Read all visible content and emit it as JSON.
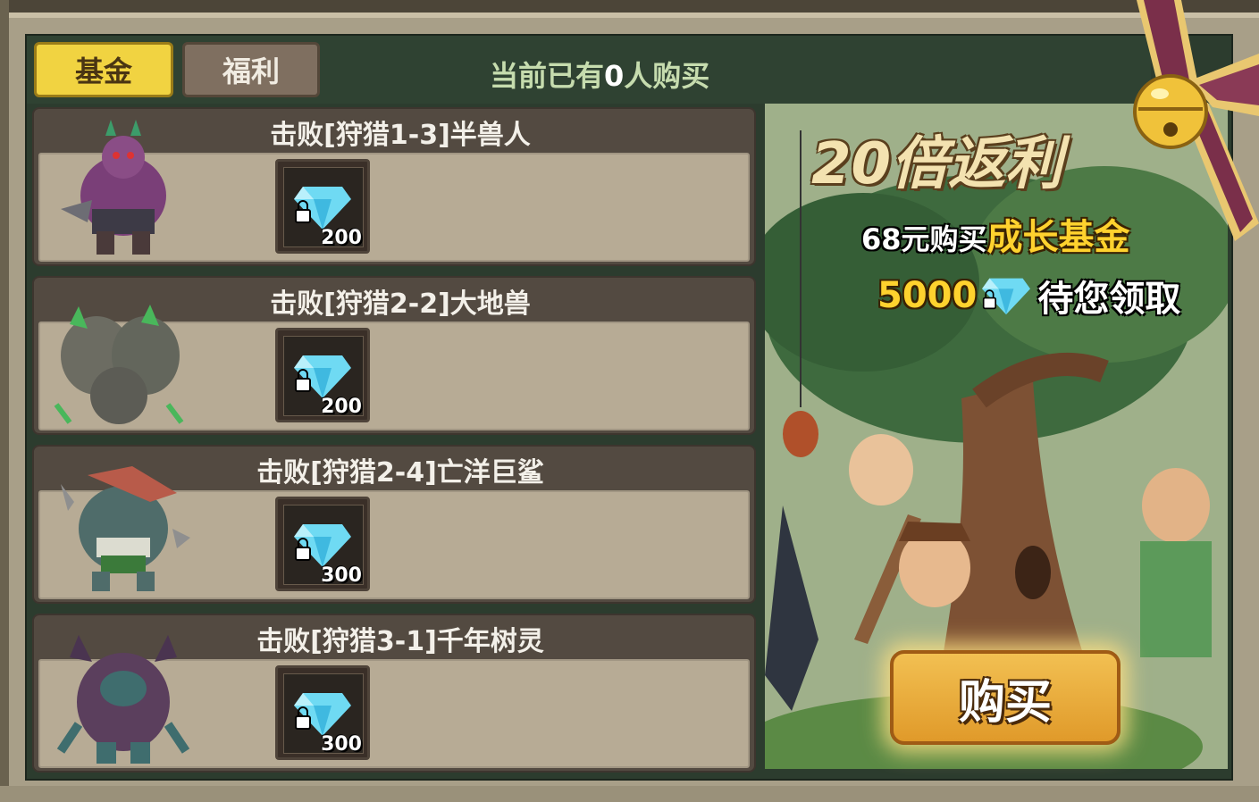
{
  "tabs": [
    {
      "label": "基金",
      "active": true
    },
    {
      "label": "福利",
      "active": false
    }
  ],
  "buyers": {
    "prefix": "当前已有",
    "count": "0",
    "suffix": "人购买"
  },
  "milestones": [
    {
      "title": "击败[狩猎1-3]半兽人",
      "reward_icon": "locked-diamond-icon",
      "amount": "200"
    },
    {
      "title": "击败[狩猎2-2]大地兽",
      "reward_icon": "locked-diamond-icon",
      "amount": "200"
    },
    {
      "title": "击败[狩猎2-4]亡洋巨鲨",
      "reward_icon": "locked-diamond-icon",
      "amount": "300"
    },
    {
      "title": "击败[狩猎3-1]千年树灵",
      "reward_icon": "locked-diamond-icon",
      "amount": "300"
    }
  ],
  "promo": {
    "headline": "20倍返利",
    "price_text": "68元购买",
    "fund_name": "成长基金",
    "diamond_amount": "5000",
    "claim_text": "待您领取",
    "buy_label": "购买"
  },
  "colors": {
    "active_tab": "#f1d341",
    "gold_text": "#ffd22e",
    "diamond": "#5fd3f0",
    "buy_button": "#e8a83a"
  }
}
